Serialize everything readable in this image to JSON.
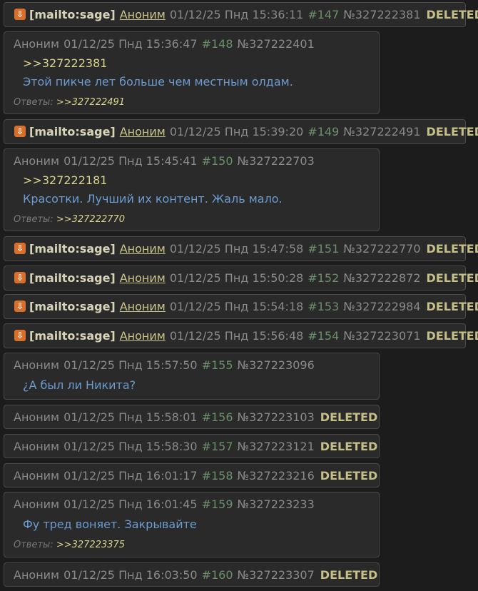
{
  "posts": [
    {
      "sage": true,
      "mailto": "[mailto:sage]",
      "name": "Аноним",
      "date": "01/12/25 Пнд 15:36:11",
      "num": "#147",
      "id": "№327222381",
      "status": "DELETED"
    },
    {
      "sage": false,
      "name": "Аноним",
      "date": "01/12/25 Пнд 15:36:47",
      "num": "#148",
      "id": "№327222401",
      "reply": ">>327222381",
      "text": "Этой пикче лет больше чем местным олдам.",
      "answers_label": "Ответы:",
      "answers": ">>327222491"
    },
    {
      "sage": true,
      "mailto": "[mailto:sage]",
      "name": "Аноним",
      "date": "01/12/25 Пнд 15:39:20",
      "num": "#149",
      "id": "№327222491",
      "status": "DELETED"
    },
    {
      "sage": false,
      "name": "Аноним",
      "date": "01/12/25 Пнд 15:45:41",
      "num": "#150",
      "id": "№327222703",
      "reply": ">>327222181",
      "text": "Красотки. Лучший их контент. Жаль мало.",
      "answers_label": "Ответы:",
      "answers": ">>327222770"
    },
    {
      "sage": true,
      "mailto": "[mailto:sage]",
      "name": "Аноним",
      "date": "01/12/25 Пнд 15:47:58",
      "num": "#151",
      "id": "№327222770",
      "status": "DELETED"
    },
    {
      "sage": true,
      "mailto": "[mailto:sage]",
      "name": "Аноним",
      "date": "01/12/25 Пнд 15:50:28",
      "num": "#152",
      "id": "№327222872",
      "status": "DELETED"
    },
    {
      "sage": true,
      "mailto": "[mailto:sage]",
      "name": "Аноним",
      "date": "01/12/25 Пнд 15:54:18",
      "num": "#153",
      "id": "№327222984",
      "status": "DELETED"
    },
    {
      "sage": true,
      "mailto": "[mailto:sage]",
      "name": "Аноним",
      "date": "01/12/25 Пнд 15:56:48",
      "num": "#154",
      "id": "№327223071",
      "status": "DELETED"
    },
    {
      "sage": false,
      "name": "Аноним",
      "date": "01/12/25 Пнд 15:57:50",
      "num": "#155",
      "id": "№327223096",
      "text": "¿А был ли Никита?"
    },
    {
      "sage": false,
      "name": "Аноним",
      "date": "01/12/25 Пнд 15:58:01",
      "num": "#156",
      "id": "№327223103",
      "status": "DELETED"
    },
    {
      "sage": false,
      "name": "Аноним",
      "date": "01/12/25 Пнд 15:58:30",
      "num": "#157",
      "id": "№327223121",
      "status": "DELETED"
    },
    {
      "sage": false,
      "name": "Аноним",
      "date": "01/12/25 Пнд 16:01:17",
      "num": "#158",
      "id": "№327223216",
      "status": "DELETED"
    },
    {
      "sage": false,
      "name": "Аноним",
      "date": "01/12/25 Пнд 16:01:45",
      "num": "#159",
      "id": "№327223233",
      "text": "Фу тред воняет. Закрывайте",
      "answers_label": "Ответы:",
      "answers": ">>327223375"
    },
    {
      "sage": false,
      "name": "Аноним",
      "date": "01/12/25 Пнд 16:03:50",
      "num": "#160",
      "id": "№327223307",
      "status": "DELETED"
    }
  ]
}
